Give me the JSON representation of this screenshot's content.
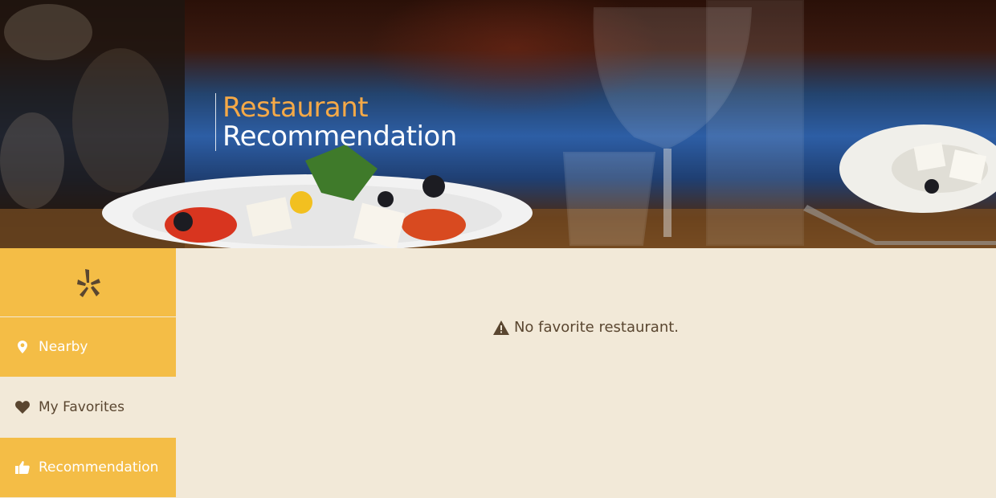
{
  "header": {
    "title_line1": "Restaurant",
    "title_line2": "Recommendation",
    "title_line1_color": "#f5a947",
    "title_line2_color": "#ffffff"
  },
  "sidebar": {
    "logo_icon": "yelp-burst-icon",
    "accent_color": "#f4bd46",
    "items": [
      {
        "label": "Nearby",
        "icon": "map-marker-icon",
        "active": false
      },
      {
        "label": "My Favorites",
        "icon": "heart-icon",
        "active": true
      },
      {
        "label": "Recommendation",
        "icon": "thumbs-up-icon",
        "active": false
      }
    ]
  },
  "main": {
    "empty_message": "No favorite restaurant.",
    "empty_icon": "warning-icon",
    "background_color": "#f2e9d8"
  }
}
